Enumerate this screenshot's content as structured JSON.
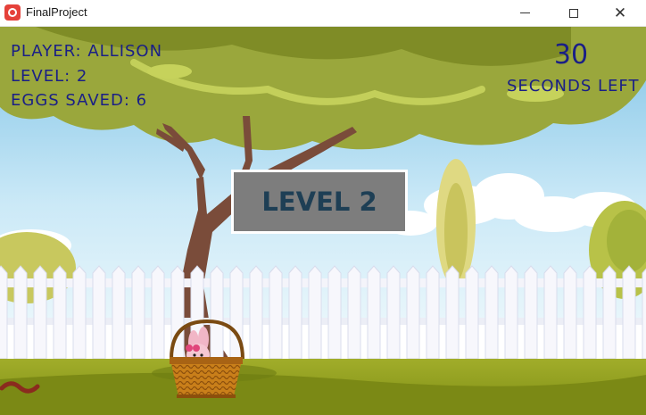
{
  "window": {
    "title": "FinalProject",
    "icon": "monogame-icon"
  },
  "hud": {
    "player": "PLAYER: ALLISON",
    "level": "LEVEL: 2",
    "eggs_saved": "EGGS SAVED: 6",
    "timer_value": "30",
    "timer_label": "SECONDS LEFT"
  },
  "banner": {
    "text": "LEVEL 2"
  },
  "colors": {
    "hud_text": "#1a1f86",
    "banner_bg": "#7d7d7d",
    "banner_text": "#1e3f55",
    "sky": "#bfe3f5",
    "grass": "#8a9a1c"
  }
}
